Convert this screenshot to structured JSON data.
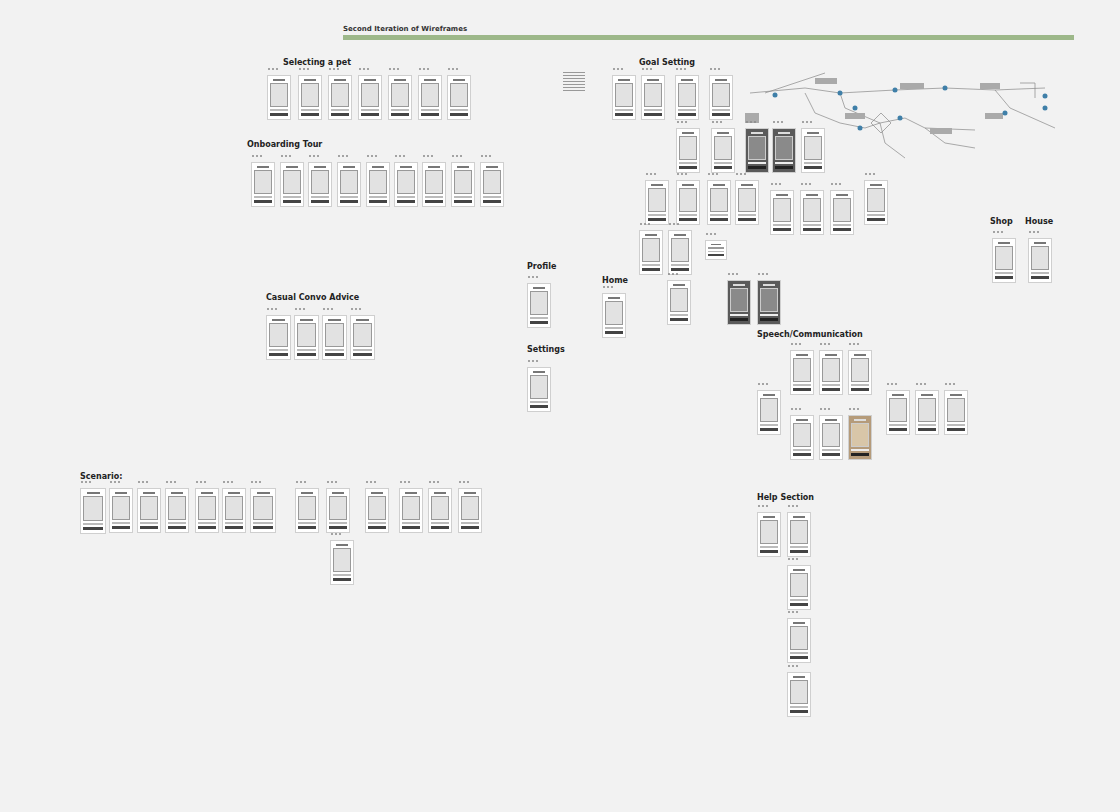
{
  "canvas": {
    "title": "Second Iteration of Wireframes"
  },
  "sections": [
    {
      "label": "Selecting a pet",
      "frames": [
        {
          "kind": "light"
        },
        {
          "kind": "light"
        },
        {
          "kind": "light"
        },
        {
          "kind": "light"
        },
        {
          "kind": "light"
        },
        {
          "kind": "light"
        },
        {
          "kind": "light"
        }
      ]
    },
    {
      "label": "Onboarding Tour",
      "frames": [
        {
          "kind": "light"
        },
        {
          "kind": "light"
        },
        {
          "kind": "light"
        },
        {
          "kind": "light"
        },
        {
          "kind": "light"
        },
        {
          "kind": "light"
        },
        {
          "kind": "light"
        },
        {
          "kind": "light"
        },
        {
          "kind": "light"
        }
      ]
    },
    {
      "label": "Casual Convo Advice",
      "frames": [
        {
          "kind": "light"
        },
        {
          "kind": "light"
        },
        {
          "kind": "light"
        },
        {
          "kind": "light"
        }
      ]
    },
    {
      "label": "Scenario:",
      "frames": [
        {
          "kind": "light"
        },
        {
          "kind": "light"
        },
        {
          "kind": "light"
        },
        {
          "kind": "light"
        },
        {
          "kind": "light"
        },
        {
          "kind": "light"
        },
        {
          "kind": "light"
        },
        {
          "kind": "light"
        },
        {
          "kind": "light"
        },
        {
          "kind": "light"
        },
        {
          "kind": "light"
        },
        {
          "kind": "light"
        },
        {
          "kind": "light"
        },
        {
          "kind": "light"
        }
      ]
    },
    {
      "label": "Profile",
      "frames": [
        {
          "kind": "light"
        }
      ]
    },
    {
      "label": "Settings",
      "frames": [
        {
          "kind": "light"
        }
      ]
    },
    {
      "label": "Home",
      "frames": [
        {
          "kind": "light"
        }
      ]
    },
    {
      "label": "Goal Setting",
      "frames": [
        {
          "kind": "light"
        },
        {
          "kind": "light"
        },
        {
          "kind": "light"
        },
        {
          "kind": "light"
        },
        {
          "kind": "light"
        },
        {
          "kind": "light"
        },
        {
          "kind": "dark"
        },
        {
          "kind": "dark"
        },
        {
          "kind": "light"
        },
        {
          "kind": "light"
        },
        {
          "kind": "light"
        },
        {
          "kind": "light"
        },
        {
          "kind": "light"
        },
        {
          "kind": "light"
        },
        {
          "kind": "light"
        },
        {
          "kind": "light"
        },
        {
          "kind": "light"
        },
        {
          "kind": "light"
        },
        {
          "kind": "light"
        },
        {
          "kind": "light"
        },
        {
          "kind": "light"
        },
        {
          "kind": "dark"
        },
        {
          "kind": "dark"
        }
      ]
    },
    {
      "label": "Shop",
      "frames": [
        {
          "kind": "light"
        }
      ]
    },
    {
      "label": "House",
      "frames": [
        {
          "kind": "light"
        }
      ]
    },
    {
      "label": "Speech/Communication",
      "frames": [
        {
          "kind": "light"
        },
        {
          "kind": "light"
        },
        {
          "kind": "light"
        },
        {
          "kind": "light"
        },
        {
          "kind": "light"
        },
        {
          "kind": "light"
        },
        {
          "kind": "light"
        },
        {
          "kind": "light"
        },
        {
          "kind": "light"
        },
        {
          "kind": "photo"
        }
      ]
    },
    {
      "label": "Help Section",
      "frames": [
        {
          "kind": "light"
        },
        {
          "kind": "light"
        },
        {
          "kind": "light"
        },
        {
          "kind": "light"
        },
        {
          "kind": "light"
        }
      ]
    }
  ]
}
